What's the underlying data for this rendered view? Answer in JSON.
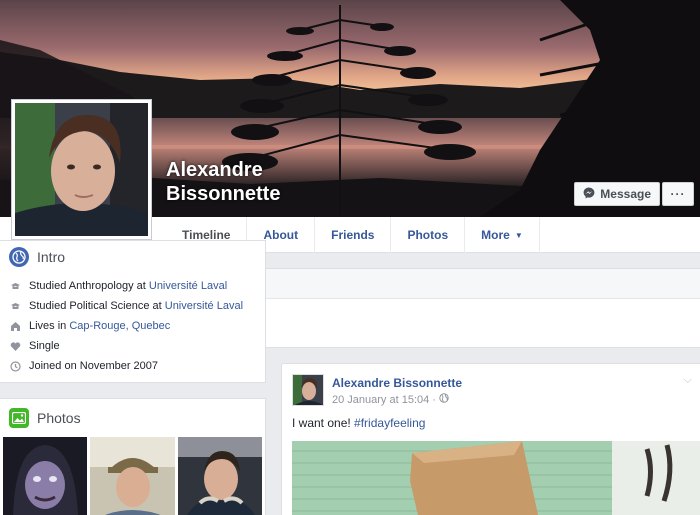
{
  "profile": {
    "name_line1": "Alexandre",
    "name_line2": "Bissonnette"
  },
  "cover_actions": {
    "message_label": "Message",
    "more_label": "···"
  },
  "nav": {
    "tabs": [
      {
        "label": "Timeline"
      },
      {
        "label": "About"
      },
      {
        "label": "Friends"
      },
      {
        "label": "Photos"
      },
      {
        "label": "More"
      }
    ]
  },
  "intro": {
    "title": "Intro",
    "items": [
      {
        "icon": "graduation-cap-icon",
        "prefix": "Studied Anthropology at ",
        "link": "Université Laval"
      },
      {
        "icon": "graduation-cap-icon",
        "prefix": "Studied Political Science at ",
        "link": "Université Laval"
      },
      {
        "icon": "home-icon",
        "prefix": "Lives in ",
        "link": "Cap-Rouge, Quebec"
      },
      {
        "icon": "heart-icon",
        "prefix": "Single",
        "link": ""
      },
      {
        "icon": "clock-icon",
        "prefix": "Joined on November 2007",
        "link": ""
      }
    ]
  },
  "photos": {
    "title": "Photos"
  },
  "post": {
    "author": "Alexandre Bissonnette",
    "timestamp": "20 January at 15:04",
    "separator": "·",
    "text_prefix": "I want one! ",
    "hashtag": "#fridayfeeling"
  },
  "colors": {
    "link": "#365899",
    "brand_blue": "#4267b2",
    "background": "#e9ebee",
    "photos_green": "#42b72a"
  }
}
